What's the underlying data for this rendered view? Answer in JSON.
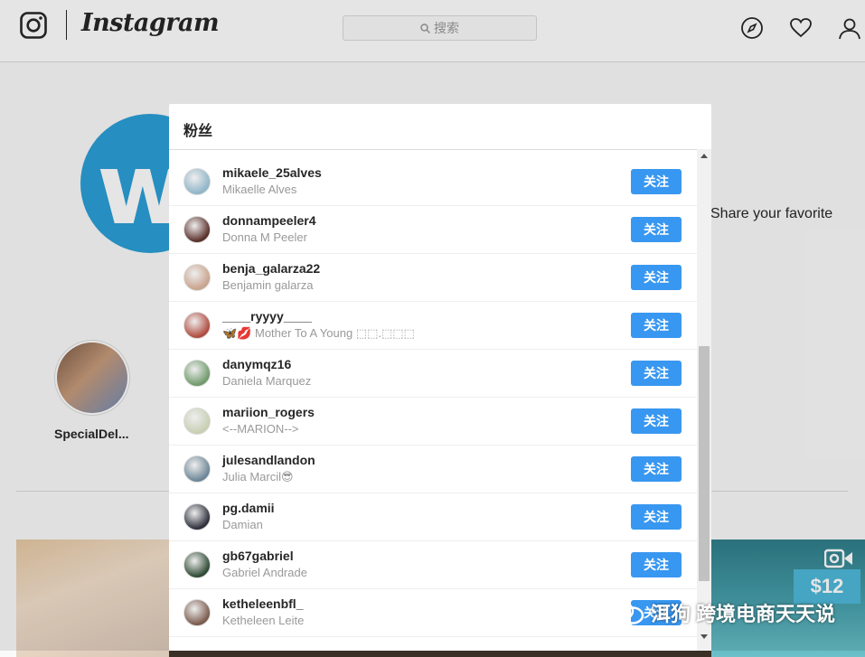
{
  "nav": {
    "brand": "Instagram",
    "search_placeholder": "搜索",
    "icons": [
      "instagram-glyph-icon",
      "compass-icon",
      "heart-icon",
      "profile-icon",
      "search-icon"
    ]
  },
  "profile": {
    "bio_snippet": "Share your favorite",
    "highlight_label": "SpecialDel...",
    "grid_price_badge": "$12"
  },
  "modal": {
    "title": "粉丝",
    "follow_label": "关注",
    "followers": [
      {
        "username": "mikaele_25alves",
        "full_name": "Mikaelle Alves",
        "avatar_color": "#8fb5c8"
      },
      {
        "username": "donnampeeler4",
        "full_name": "Donna M Peeler",
        "avatar_color": "#5a2f2a"
      },
      {
        "username": "benja_galarza22",
        "full_name": "Benjamin galarza",
        "avatar_color": "#c9a38c"
      },
      {
        "username": "____ryyyy____",
        "full_name": "🦋💋 Mother To A Young ⬚⬚.⬚⬚⬚",
        "avatar_color": "#b04b3e"
      },
      {
        "username": "danymqz16",
        "full_name": "Daniela Marquez",
        "avatar_color": "#6f9a6a"
      },
      {
        "username": "mariion_rogers",
        "full_name": "<--MARION-->",
        "avatar_color": "#c7cfb3"
      },
      {
        "username": "julesandlandon",
        "full_name": "Julia Marcil😎",
        "avatar_color": "#6c8596"
      },
      {
        "username": "pg.damii",
        "full_name": "Damian",
        "avatar_color": "#2c2f3a"
      },
      {
        "username": "gb67gabriel",
        "full_name": "Gabriel Andrade",
        "avatar_color": "#2f4a34"
      },
      {
        "username": "ketheleenbfl_",
        "full_name": "Ketheleen Leite",
        "avatar_color": "#7b5b4d"
      }
    ]
  },
  "watermark": {
    "text": "跨境电商天天说",
    "partial_text": "洱狗"
  },
  "colors": {
    "follow_button": "#3897f0",
    "brand_avatar": "#2b9fd6"
  }
}
